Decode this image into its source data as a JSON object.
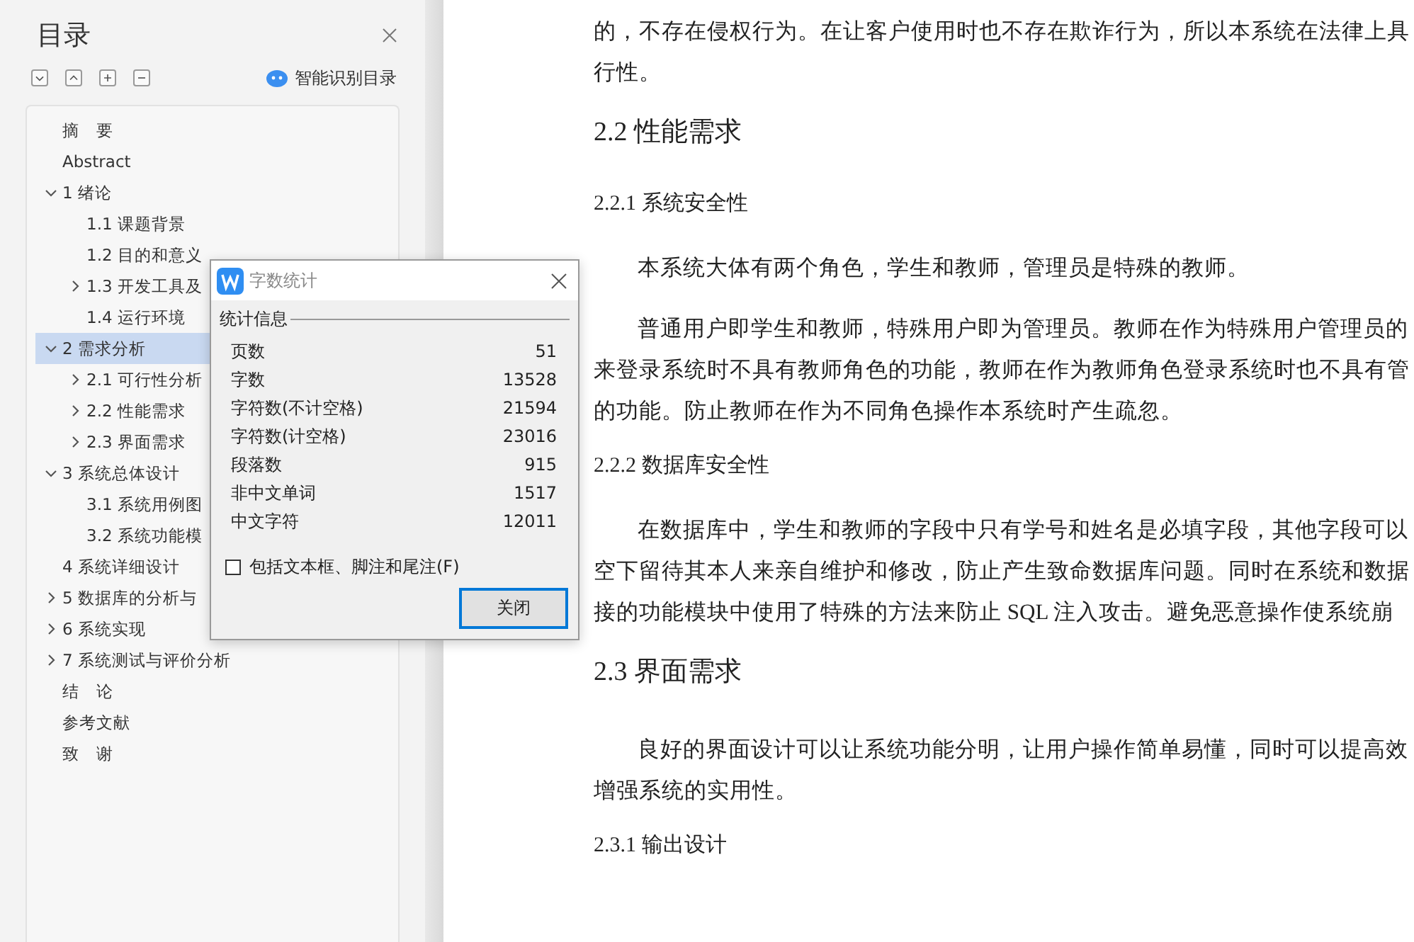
{
  "toc": {
    "title": "目录",
    "smart_button": "智能识别目录",
    "items": [
      {
        "label": "摘　要",
        "selected": false
      },
      {
        "label": "Abstract",
        "selected": false
      },
      {
        "label": "1 绪论",
        "selected": false,
        "expanded": true,
        "children": [
          {
            "label": "1.1 课题背景",
            "selected": false
          },
          {
            "label": "1.2 目的和意义",
            "selected": false
          },
          {
            "label": "1.3 开发工具及",
            "selected": false,
            "expanded": false
          },
          {
            "label": "1.4 运行环境",
            "selected": false
          }
        ]
      },
      {
        "label": "2  需求分析",
        "selected": true,
        "expanded": true,
        "children": [
          {
            "label": "2.1 可行性分析",
            "selected": false,
            "expanded": false
          },
          {
            "label": "2.2 性能需求",
            "selected": false,
            "expanded": false
          },
          {
            "label": "2.3 界面需求",
            "selected": false,
            "expanded": false
          }
        ]
      },
      {
        "label": "3  系统总体设计",
        "selected": false,
        "expanded": true,
        "children": [
          {
            "label": "3.1  系统用例图",
            "selected": false
          },
          {
            "label": "3.2  系统功能模",
            "selected": false
          }
        ]
      },
      {
        "label": "4 系统详细设计",
        "selected": false
      },
      {
        "label": "5 数据库的分析与",
        "selected": false,
        "expanded": false
      },
      {
        "label": "6 系统实现",
        "selected": false,
        "expanded": false
      },
      {
        "label": "7 系统测试与评价分析",
        "selected": false,
        "expanded": false
      },
      {
        "label": "结　论",
        "selected": false
      },
      {
        "label": "参考文献",
        "selected": false
      },
      {
        "label": "致　谢",
        "selected": false
      }
    ]
  },
  "dialog": {
    "title": "字数统计",
    "group": "统计信息",
    "stats": [
      {
        "label": "页数",
        "value": "51"
      },
      {
        "label": "字数",
        "value": "13528"
      },
      {
        "label": "字符数(不计空格)",
        "value": "21594"
      },
      {
        "label": "字符数(计空格)",
        "value": "23016"
      },
      {
        "label": "段落数",
        "value": "915"
      },
      {
        "label": "非中文单词",
        "value": "1517"
      },
      {
        "label": "中文字符",
        "value": "12011"
      }
    ],
    "checkbox": {
      "label": "包括文本框、脚注和尾注(F)",
      "checked": false
    },
    "button": "关闭"
  },
  "document": [
    {
      "kind": "para",
      "indent": false,
      "lines": [
        "的，不存在侵权行为。在让客户使用时也不存在欺诈行为，所以本系统在法律上具",
        "行性。"
      ]
    },
    {
      "kind": "h2",
      "text": "2.2 性能需求"
    },
    {
      "kind": "h3",
      "text": "2.2.1  系统安全性"
    },
    {
      "kind": "para",
      "indent": true,
      "lines": [
        "本系统大体有两个角色，学生和教师，管理员是特殊的教师。"
      ]
    },
    {
      "kind": "para",
      "indent": true,
      "lines": [
        "普通用户即学生和教师，特殊用户即为管理员。教师在作为特殊用户管理员的",
        "来登录系统时不具有教师角色的功能，教师在作为教师角色登录系统时也不具有管",
        "的功能。防止教师在作为不同角色操作本系统时产生疏忽。"
      ]
    },
    {
      "kind": "h3",
      "text": "2.2.2  数据库安全性"
    },
    {
      "kind": "para",
      "indent": true,
      "lines": [
        "在数据库中，学生和教师的字段中只有学号和姓名是必填字段，其他字段可以",
        "空下留待其本人来亲自维护和修改，防止产生致命数据库问题。同时在系统和数据",
        "接的功能模块中使用了特殊的方法来防止 SQL 注入攻击。避免恶意操作使系统崩"
      ]
    },
    {
      "kind": "h2",
      "text": "2.3 界面需求"
    },
    {
      "kind": "para",
      "indent": true,
      "lines": [
        "良好的界面设计可以让系统功能分明，让用户操作简单易懂，同时可以提高效",
        "增强系统的实用性。"
      ]
    },
    {
      "kind": "h3",
      "text": "2.3.1 输出设计"
    }
  ]
}
